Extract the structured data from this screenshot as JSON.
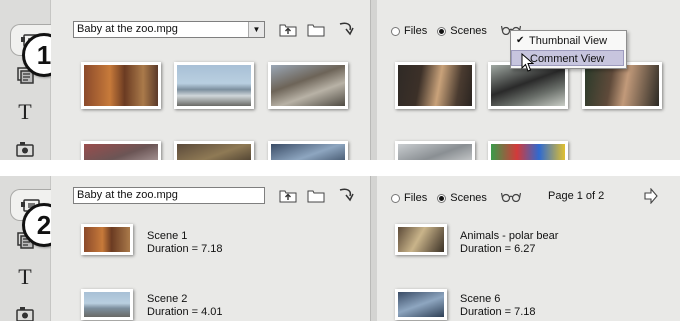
{
  "panel1": {
    "badge": "1",
    "file_select": "Baby at the zoo.mpg",
    "radio_files": "Files",
    "radio_scenes": "Scenes",
    "menu": {
      "items": [
        "Thumbnail View",
        "Comment View"
      ],
      "checked_index": 0,
      "highlighted_index": 1
    }
  },
  "panel2": {
    "badge": "2",
    "file_select": "Baby at the zoo.mpg",
    "radio_files": "Files",
    "radio_scenes": "Scenes",
    "page_label": "Page 1 of 2",
    "scenes_left": [
      {
        "title": "Scene 1",
        "duration": "Duration = 7.18"
      },
      {
        "title": "Scene 2",
        "duration": "Duration = 4.01"
      }
    ],
    "scenes_right": [
      {
        "title": "Animals - polar bear",
        "duration": "Duration = 6.27"
      },
      {
        "title": "Scene 6",
        "duration": "Duration = 7.18"
      }
    ]
  },
  "icons": [
    "video-library-icon",
    "transitions-icon",
    "title-text-icon",
    "photo-icon",
    "up-folder-icon",
    "folder-icon",
    "go-back-icon",
    "glasses-icon",
    "next-page-arrow-icon",
    "checkmark-icon",
    "mouse-cursor-icon"
  ],
  "colors": {
    "panel_bg": "#e9e9e7",
    "menu_highlight": "#c7c5de",
    "divider": "#d4d4d2"
  }
}
